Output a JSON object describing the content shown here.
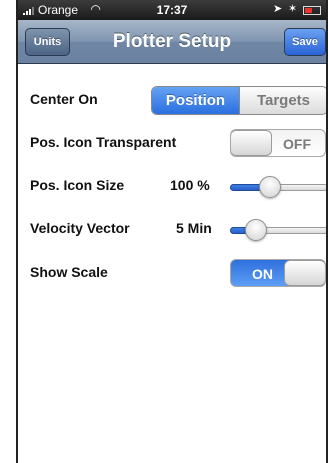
{
  "status_bar": {
    "carrier": "Orange",
    "time": "17:37",
    "wifi_icon": "wifi-icon",
    "location_icon": "location-arrow-icon",
    "bluetooth_icon": "bluetooth-icon",
    "battery_icon": "battery-icon",
    "battery_color": "#e33333"
  },
  "navbar": {
    "title": "Plotter Setup",
    "left_button": "Units",
    "right_button": "Save",
    "accent": "#2a63d8"
  },
  "settings": {
    "center_on": {
      "label": "Center On",
      "options": [
        "Position",
        "Targets"
      ],
      "selected": "Position"
    },
    "icon_transparent": {
      "label": "Pos. Icon Transparent",
      "state": "OFF"
    },
    "icon_size": {
      "label": "Pos. Icon Size",
      "value": "100 %",
      "level": 0.38
    },
    "velocity_vector": {
      "label": "Velocity Vector",
      "value": "5 Min",
      "level": 0.2
    },
    "show_scale": {
      "label": "Show Scale",
      "state": "ON"
    }
  }
}
